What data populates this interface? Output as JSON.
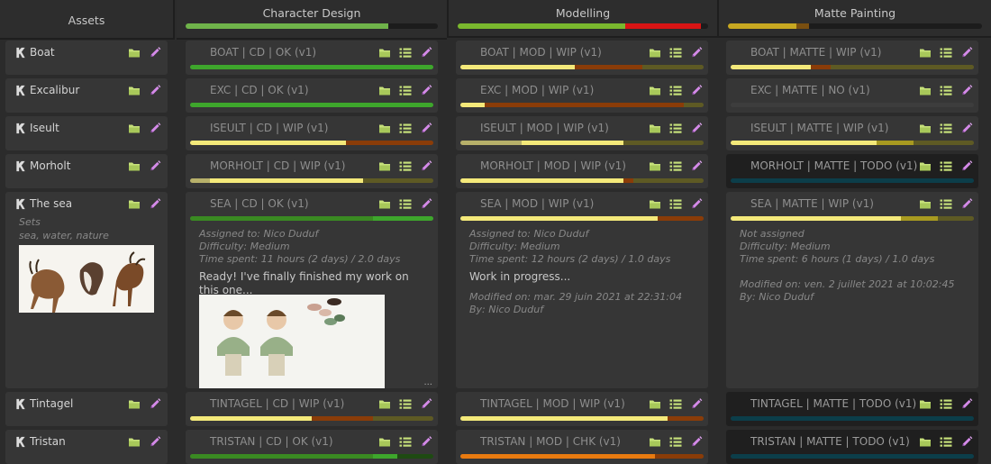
{
  "header": {
    "assets_title": "Assets",
    "columns": [
      {
        "title": "Character Design",
        "progress": [
          {
            "color": "#6fb34a",
            "fraction": 0.805
          }
        ]
      },
      {
        "title": "Modelling",
        "progress": [
          {
            "color": "#7ab82e",
            "fraction": 0.67
          },
          {
            "color": "#d81414",
            "fraction": 0.3
          }
        ]
      },
      {
        "title": "Matte Painting",
        "progress": [
          {
            "color": "#c8a821",
            "fraction": 0.27
          },
          {
            "color": "#7a4f10",
            "fraction": 0.05
          }
        ]
      }
    ]
  },
  "assets": [
    {
      "name": "Boat",
      "row": 0
    },
    {
      "name": "Excalibur",
      "row": 1
    },
    {
      "name": "Iseult",
      "row": 2
    },
    {
      "name": "Morholt",
      "row": 3
    },
    {
      "name": "The sea",
      "row": 4,
      "sets_label": "Sets",
      "tags": "sea, water, nature"
    },
    {
      "name": "Tintagel",
      "row": 5
    },
    {
      "name": "Tristan",
      "row": 6
    }
  ],
  "tasks": {
    "cd": [
      {
        "title": "BOAT | CD | OK (v1)",
        "bar": [
          {
            "color": "#3ea62c",
            "fraction": 1.0
          }
        ]
      },
      {
        "title": "EXC | CD | OK (v1)",
        "bar": [
          {
            "color": "#3ea62c",
            "fraction": 1.0
          }
        ]
      },
      {
        "title": "ISEULT | CD | WIP (v1)",
        "bar": [
          {
            "color": "#f4e97a",
            "fraction": 0.64
          },
          {
            "color": "#8a3c08",
            "fraction": 0.36
          }
        ]
      },
      {
        "title": "MORHOLT | CD | WIP (v1)",
        "bar": [
          {
            "color": "#b7b06a",
            "fraction": 0.08
          },
          {
            "color": "#f4e97a",
            "fraction": 0.63
          },
          {
            "color": "#5e5a24",
            "fraction": 0.29
          }
        ]
      },
      {
        "title": "SEA | CD | OK (v1)",
        "bar": [
          {
            "color": "#3a8a22",
            "fraction": 0.75
          },
          {
            "color": "#3ea62c",
            "fraction": 0.25
          }
        ],
        "assigned": "Assigned to: Nico Duduf",
        "difficulty": "Difficulty: Medium",
        "time": "Time spent: 11 hours (2 days) / 2.0 days",
        "comment": "Ready! I've finally finished my work on this one...",
        "more": "..."
      },
      {
        "title": "TINTAGEL | CD | WIP (v1)",
        "bar": [
          {
            "color": "#f4e97a",
            "fraction": 0.5
          },
          {
            "color": "#8a3c08",
            "fraction": 0.25
          },
          {
            "color": "#5e5a24",
            "fraction": 0.25
          }
        ]
      },
      {
        "title": "TRISTAN | CD | OK (v1)",
        "bar": [
          {
            "color": "#3a8a22",
            "fraction": 0.75
          },
          {
            "color": "#3ea62c",
            "fraction": 0.1
          },
          {
            "color": "#1e4a12",
            "fraction": 0.15
          }
        ]
      }
    ],
    "mod": [
      {
        "title": "BOAT | MOD | WIP (v1)",
        "bar": [
          {
            "color": "#f4e97a",
            "fraction": 0.47
          },
          {
            "color": "#8a3c08",
            "fraction": 0.28
          },
          {
            "color": "#5e5a24",
            "fraction": 0.25
          }
        ]
      },
      {
        "title": "EXC | MOD | WIP (v1)",
        "bar": [
          {
            "color": "#f4e97a",
            "fraction": 0.1
          },
          {
            "color": "#8a3c08",
            "fraction": 0.82
          },
          {
            "color": "#5e5a24",
            "fraction": 0.08
          }
        ]
      },
      {
        "title": "ISEULT | MOD | WIP (v1)",
        "bar": [
          {
            "color": "#b7b06a",
            "fraction": 0.25
          },
          {
            "color": "#f4e97a",
            "fraction": 0.42
          },
          {
            "color": "#5e5a24",
            "fraction": 0.33
          }
        ]
      },
      {
        "title": "MORHOLT | MOD | WIP (v1)",
        "bar": [
          {
            "color": "#f4e97a",
            "fraction": 0.67
          },
          {
            "color": "#8a3c08",
            "fraction": 0.04
          },
          {
            "color": "#5e5a24",
            "fraction": 0.29
          }
        ]
      },
      {
        "title": "SEA | MOD | WIP (v1)",
        "bar": [
          {
            "color": "#f4e97a",
            "fraction": 0.81
          },
          {
            "color": "#8a3c08",
            "fraction": 0.19
          }
        ],
        "assigned": "Assigned to: Nico Duduf",
        "difficulty": "Difficulty: Medium",
        "time": "Time spent: 12 hours (2 days) / 1.0 days",
        "comment": "Work in progress...",
        "modified": "Modified on: mar. 29 juin 2021 at 22:31:04",
        "by": "By: Nico Duduf"
      },
      {
        "title": "TINTAGEL | MOD | WIP (v1)",
        "bar": [
          {
            "color": "#f4e97a",
            "fraction": 0.85
          },
          {
            "color": "#8a3c08",
            "fraction": 0.15
          }
        ]
      },
      {
        "title": "TRISTAN | MOD | CHK (v1)",
        "bar": [
          {
            "color": "#e87a10",
            "fraction": 0.8
          },
          {
            "color": "#8a3c08",
            "fraction": 0.2
          }
        ]
      }
    ],
    "matte": [
      {
        "title": "BOAT | MATTE | WIP (v1)",
        "bar": [
          {
            "color": "#f4e97a",
            "fraction": 0.33
          },
          {
            "color": "#8a3c08",
            "fraction": 0.08
          },
          {
            "color": "#5e5a24",
            "fraction": 0.59
          }
        ]
      },
      {
        "title": "EXC | MATTE | NO (v1)",
        "bar": [
          {
            "color": "#3d3d3d",
            "fraction": 1.0
          }
        ]
      },
      {
        "title": "ISEULT | MATTE | WIP (v1)",
        "bar": [
          {
            "color": "#f4e97a",
            "fraction": 0.6
          },
          {
            "color": "#a89a20",
            "fraction": 0.15
          },
          {
            "color": "#5e5a24",
            "fraction": 0.25
          }
        ]
      },
      {
        "title": "MORHOLT | MATTE | TODO (v1)",
        "dark": true,
        "bar": [
          {
            "color": "#0c3e4a",
            "fraction": 1.0
          }
        ]
      },
      {
        "title": "SEA | MATTE | WIP (v1)",
        "bar": [
          {
            "color": "#f4e97a",
            "fraction": 0.7
          },
          {
            "color": "#a89a20",
            "fraction": 0.15
          },
          {
            "color": "#5e5a24",
            "fraction": 0.15
          }
        ],
        "assigned": "Not assigned",
        "difficulty": "Difficulty: Medium",
        "time": "Time spent: 6 hours (1 days) / 1.0 days",
        "modified": "Modified on: ven. 2 juillet 2021 at 10:02:45",
        "by": "By: Nico Duduf"
      },
      {
        "title": "TINTAGEL | MATTE | TODO (v1)",
        "dark": true,
        "bar": [
          {
            "color": "#0c3e4a",
            "fraction": 1.0
          }
        ]
      },
      {
        "title": "TRISTAN | MATTE | TODO (v1)",
        "dark": true,
        "bar": [
          {
            "color": "#0c3e4a",
            "fraction": 1.0
          }
        ]
      }
    ]
  },
  "icons": {
    "asset": "asset-icon",
    "folder": "folder-icon",
    "list": "list-icon",
    "edit": "pencil-icon"
  }
}
